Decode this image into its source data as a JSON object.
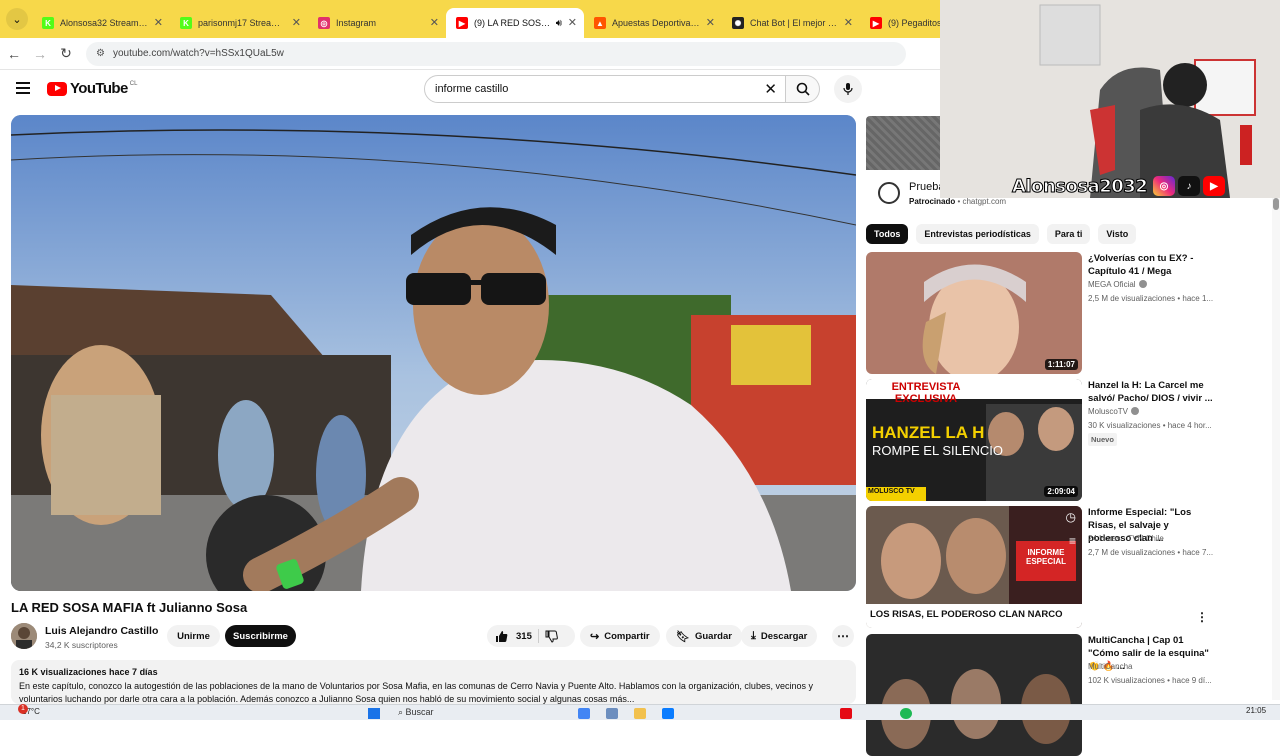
{
  "browser": {
    "tabs": [
      {
        "title": "Alonsosa32 Stream - Wat",
        "color": "#53fc18",
        "glyph": "K",
        "active": false
      },
      {
        "title": "parisonmj17 Stream - Wa",
        "color": "#53fc18",
        "glyph": "K",
        "active": false
      },
      {
        "title": "Instagram",
        "color": "#e1306c",
        "glyph": "◎",
        "active": false
      },
      {
        "title": "(9) LA RED SOSA MA",
        "color": "#ff0000",
        "glyph": "▶",
        "active": true
      },
      {
        "title": "Apuestas Deportivas - Ap",
        "color": "#ff5500",
        "glyph": "▲",
        "active": false
      },
      {
        "title": "Chat Bot | El mejor softw",
        "color": "#222222",
        "glyph": "✺",
        "active": false
      },
      {
        "title": "(9) Pegaditos has",
        "color": "#ff0000",
        "glyph": "▶",
        "active": false
      }
    ],
    "url": "youtube.com/watch?v=hSSx1QUaL5w"
  },
  "youtube": {
    "logo_text": "YouTube",
    "country": "CL",
    "search_value": "informe castillo"
  },
  "video": {
    "title": "LA RED SOSA MAFIA ft Julianno Sosa",
    "channel": "Luis Alejandro Castillo",
    "subscribers": "34,2 K suscriptores",
    "join_label": "Unirme",
    "subscribe_label": "Suscribirme",
    "likes": "315",
    "share_label": "Compartir",
    "save_label": "Guardar",
    "download_label": "Descargar",
    "views_date": "16 K visualizaciones  hace 7 días",
    "description": "En este capítulo, conozco la autogestión de las poblaciones de la mano de Voluntarios por Sosa Mafia, en las comunas de Cerro Navia y Puente Alto. Hablamos con la organización, clubes, vecinos y voluntarios luchando por darle otra cara a la población. Además conozco a Julianno Sosa quien nos habló de su movimiento social y algunas cosas más..."
  },
  "ad": {
    "title": "Prueba",
    "sponsored": "Patrocinado",
    "domain": "chatgpt.com"
  },
  "chips": [
    "Todos",
    "Entrevistas periodísticas",
    "Para ti",
    "Visto"
  ],
  "recommendations": [
    {
      "title": "¿Volverías con tu EX? - Capítulo 41 / Mega",
      "channel": "MEGA Oficial",
      "meta": "2,5 M de visualizaciones • hace 1...",
      "duration": "1:11:07",
      "badge": ""
    },
    {
      "title": "Hanzel la H: La Carcel me salvó/ Pacho/ DIOS / vivir ...",
      "channel": "MoluscoTV",
      "meta": "30 K visualizaciones • hace 4 hor...",
      "duration": "2:09:04",
      "badge": "Nuevo",
      "thumb_top": "ENTREVISTA EXCLUSIVA",
      "thumb_main": "HANZEL LA H",
      "thumb_sub": "ROMPE EL SILENCIO",
      "thumb_brand": "MOLUSCO TV"
    },
    {
      "title": "Informe Especial: \"Los Risas, el salvaje y poderoso clan ...",
      "channel": "24 Horas - TVN Chile",
      "meta": "2,7 M de visualizaciones • hace 7...",
      "duration": "",
      "badge": "",
      "thumb_caption": "LOS RISAS, EL PODEROSO CLAN NARCO",
      "thumb_tag": "INFORME ESPECIAL"
    },
    {
      "title": "MultiCancha | Cap 01 \"Cómo salir de la esquina\" 👏 🔥 ...",
      "channel": "MultiCancha",
      "meta": "102 K visualizaciones • hace 9 dí...",
      "duration": "",
      "badge": ""
    }
  ],
  "overlay": {
    "streamer_name": "Alonsosa2032",
    "social_icons": [
      "instagram-icon",
      "tiktok-icon",
      "youtube-icon"
    ]
  },
  "taskbar": {
    "weather": "17°C",
    "search_label": "Buscar",
    "time": "21:05",
    "notifications": "1"
  },
  "colors": {
    "accent": "#ff0000",
    "tabbar": "#f7d84a"
  }
}
